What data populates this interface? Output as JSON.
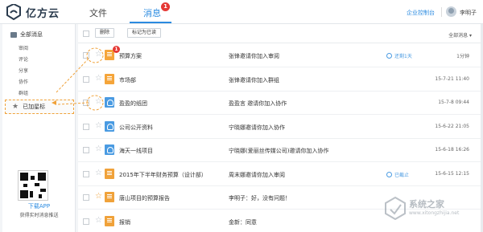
{
  "app": {
    "name": "亿方云",
    "nav": {
      "files": "文件",
      "messages": "消息",
      "messages_badge": "1"
    },
    "console_link": "企业控制台",
    "username": "李明子"
  },
  "sidebar": {
    "all_messages": "全部消息",
    "subitems": [
      "审阅",
      "评论",
      "分享",
      "协作",
      "群组"
    ],
    "starred": "已加星标",
    "download_app": "下载APP",
    "realtime_hint": "获得实时消息推送"
  },
  "toolbar": {
    "delete_label": "删除",
    "mark_read_label": "标记为已读",
    "filter_label": "全部消息"
  },
  "messages": [
    {
      "title": "预算方案",
      "text": "张锋邀请你加入审阅",
      "status": "还剩1天",
      "time": "1分钟",
      "icon": "orange",
      "badge": "1",
      "starred": false
    },
    {
      "title": "市场部",
      "text": "张锋邀请你加入群组",
      "status": "",
      "time": "15-7-21 11:40",
      "icon": "orange",
      "badge": "",
      "starred": false
    },
    {
      "title": "盈盈的纸团",
      "text": "盈盈言 邀请你加入协作",
      "status": "",
      "time": "15-7-8 09:44",
      "icon": "blue",
      "badge": "",
      "starred": false
    },
    {
      "title": "公司公开资料",
      "text": "宁晓娜邀请你加入协作",
      "status": "",
      "time": "15-6-22 21:05",
      "icon": "blue",
      "badge": "",
      "starred": false
    },
    {
      "title": "海天一线项目",
      "text": "宁晓娜(爱丽丝传媒公司)邀请你加入协作",
      "status": "",
      "time": "15-6-18 16:26",
      "icon": "blue",
      "badge": "",
      "starred": false
    },
    {
      "title": "2015年下半年财务预算（设计部）",
      "text": "周末娜邀请你加入审阅",
      "status": "已截止",
      "time": "15-6-15 12:15",
      "icon": "orange-doc",
      "badge": "",
      "starred": false
    },
    {
      "title": "唐山项目的预算报告",
      "text": "李明子：好，没有问题！",
      "status": "",
      "time": "",
      "icon": "orange-doc",
      "badge": "",
      "starred": true
    },
    {
      "title": "报销",
      "text": "金新：同意",
      "status": "",
      "time": "",
      "icon": "orange-doc",
      "badge": "",
      "starred": false
    }
  ],
  "watermark": {
    "text": "系统之家",
    "url": "www.xitongzhijia.net"
  },
  "colors": {
    "accent": "#2b8be0",
    "badge": "#e53935",
    "star_highlight": "#f0a23a"
  }
}
